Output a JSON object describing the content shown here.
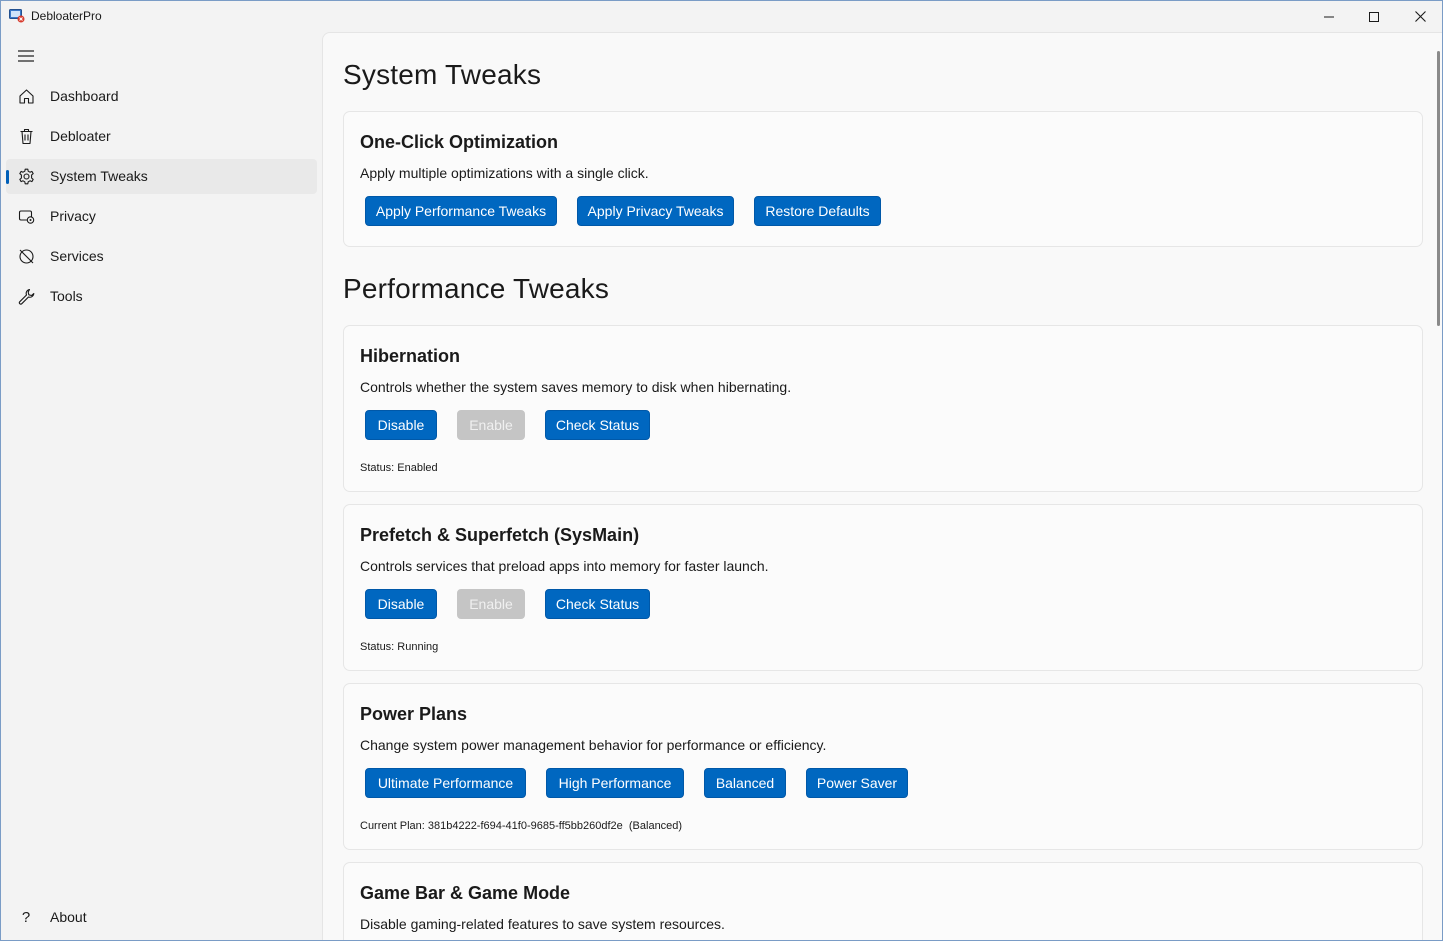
{
  "window": {
    "title": "DebloaterPro",
    "controls": {
      "minimize": "—",
      "maximize": "☐",
      "close": "✕"
    }
  },
  "sidebar": {
    "menu_icon": "hamburger-icon",
    "items": [
      {
        "label": "Dashboard",
        "icon": "home-icon",
        "active": false
      },
      {
        "label": "Debloater",
        "icon": "trash-icon",
        "active": false
      },
      {
        "label": "System Tweaks",
        "icon": "gear-icon",
        "active": true
      },
      {
        "label": "Privacy",
        "icon": "privacy-icon",
        "active": false
      },
      {
        "label": "Services",
        "icon": "services-icon",
        "active": false
      },
      {
        "label": "Tools",
        "icon": "wrench-icon",
        "active": false
      }
    ],
    "footer": {
      "label": "About",
      "icon": "question-icon"
    }
  },
  "main": {
    "page_title": "System Tweaks",
    "one_click": {
      "title": "One-Click Optimization",
      "description": "Apply multiple optimizations with a single click.",
      "buttons": [
        "Apply Performance Tweaks",
        "Apply Privacy Tweaks",
        "Restore Defaults"
      ]
    },
    "performance_title": "Performance Tweaks",
    "hibernation": {
      "title": "Hibernation",
      "description": "Controls whether the system saves memory to disk when hibernating.",
      "buttons": [
        "Disable",
        "Enable",
        "Check Status"
      ],
      "status": "Status: Enabled"
    },
    "prefetch": {
      "title": "Prefetch & Superfetch (SysMain)",
      "description": "Controls services that preload apps into memory for faster launch.",
      "buttons": [
        "Disable",
        "Enable",
        "Check Status"
      ],
      "status": "Status: Running"
    },
    "power_plans": {
      "title": "Power Plans",
      "description": "Change system power management behavior for performance or efficiency.",
      "buttons": [
        "Ultimate Performance",
        "High Performance",
        "Balanced",
        "Power Saver"
      ],
      "status": "Current Plan: 381b4222-f694-41f0-9685-ff5bb260df2e  (Balanced)"
    },
    "game_bar": {
      "title": "Game Bar & Game Mode",
      "description": "Disable gaming-related features to save system resources."
    }
  },
  "colors": {
    "accent": "#0067c0",
    "disabled": "#c5c5c5",
    "background": "#f3f3f3",
    "card": "#fbfbfb"
  }
}
